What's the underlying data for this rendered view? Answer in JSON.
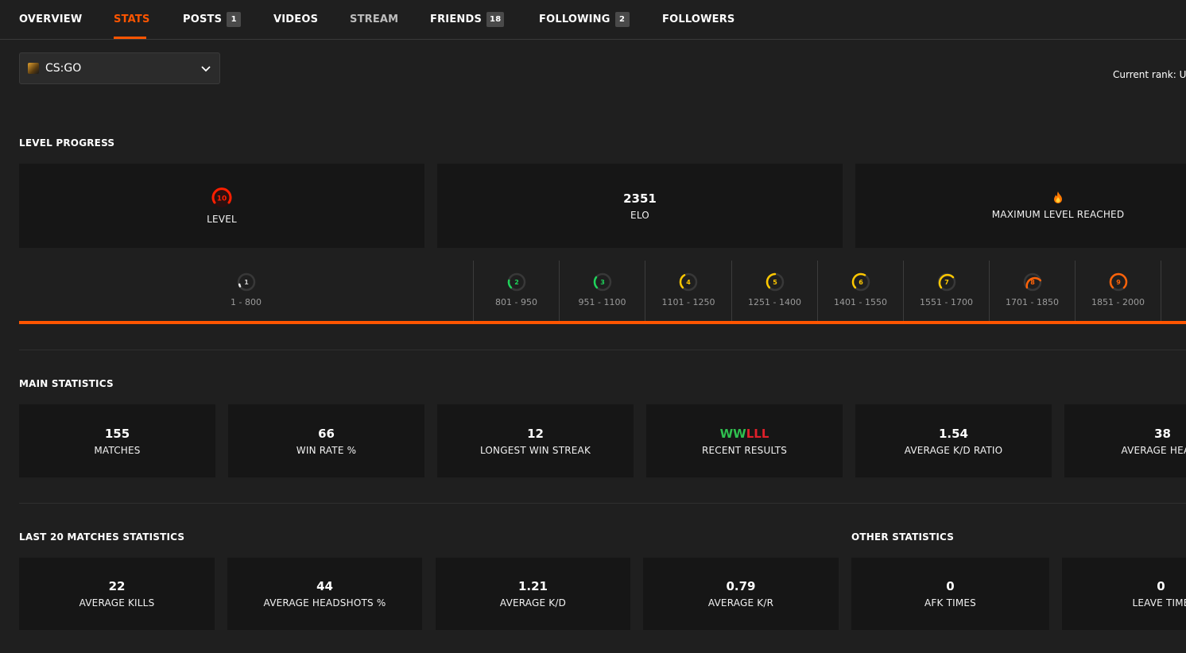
{
  "tabs": [
    {
      "label": "OVERVIEW"
    },
    {
      "label": "STATS"
    },
    {
      "label": "POSTS",
      "badge": "1"
    },
    {
      "label": "VIDEOS"
    },
    {
      "label": "STREAM"
    },
    {
      "label": "FRIENDS",
      "badge": "18"
    },
    {
      "label": "FOLLOWING",
      "badge": "2"
    },
    {
      "label": "FOLLOWERS"
    }
  ],
  "game_select": {
    "value": "CS:GO"
  },
  "current_rank_label": "Current rank: U",
  "level_progress": {
    "title": "LEVEL PROGRESS",
    "level": {
      "value": "10",
      "label": "LEVEL"
    },
    "elo": {
      "value": "2351",
      "label": "ELO"
    },
    "max": {
      "label": "MAXIMUM LEVEL REACHED"
    },
    "levels": [
      {
        "num": "1",
        "range": "1 - 800",
        "color": "#e8e8e8"
      },
      {
        "num": "2",
        "range": "801 - 950",
        "color": "#1ed35a"
      },
      {
        "num": "3",
        "range": "951 - 1100",
        "color": "#1ed35a"
      },
      {
        "num": "4",
        "range": "1101 - 1250",
        "color": "#ffc800"
      },
      {
        "num": "5",
        "range": "1251 - 1400",
        "color": "#ffc800"
      },
      {
        "num": "6",
        "range": "1401 - 1550",
        "color": "#ffc800"
      },
      {
        "num": "7",
        "range": "1551 - 1700",
        "color": "#ffc800"
      },
      {
        "num": "8",
        "range": "1701 - 1850",
        "color": "#ff6309"
      },
      {
        "num": "9",
        "range": "1851 - 2000",
        "color": "#ff6309"
      }
    ]
  },
  "main_statistics": {
    "title": "MAIN STATISTICS",
    "cards": [
      {
        "value": "155",
        "label": "MATCHES"
      },
      {
        "value": "66",
        "label": "WIN RATE %"
      },
      {
        "value": "12",
        "label": "LONGEST WIN STREAK"
      },
      {
        "value": "",
        "label": "RECENT RESULTS"
      },
      {
        "value": "1.54",
        "label": "AVERAGE K/D RATIO"
      },
      {
        "value": "38",
        "label": "AVERAGE HEADS"
      }
    ],
    "recent_results": [
      "W",
      "W",
      "L",
      "L",
      "L"
    ]
  },
  "last20": {
    "title": "LAST 20 MATCHES STATISTICS",
    "cards": [
      {
        "value": "22",
        "label": "AVERAGE KILLS"
      },
      {
        "value": "44",
        "label": "AVERAGE HEADSHOTS %"
      },
      {
        "value": "1.21",
        "label": "AVERAGE K/D"
      },
      {
        "value": "0.79",
        "label": "AVERAGE K/R"
      }
    ]
  },
  "other": {
    "title": "OTHER STATISTICS",
    "cards": [
      {
        "value": "0",
        "label": "AFK TIMES"
      },
      {
        "value": "0",
        "label": "LEAVE TIME"
      }
    ]
  },
  "colors": {
    "accent": "#ff5500",
    "win": "#2fbf4f",
    "loss": "#e0202a",
    "level10": "#fe1f00"
  }
}
